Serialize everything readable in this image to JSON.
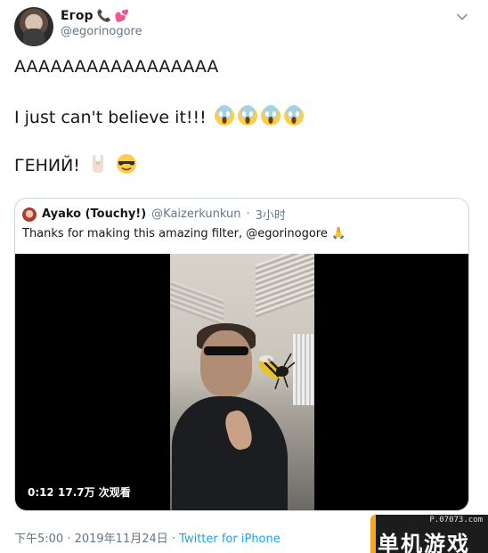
{
  "author": {
    "display_name": "Егор",
    "handle": "@egorinogore"
  },
  "tweet_lines": [
    "AAAAAAAAAAAAAAAAA",
    "I just can't believe it!!!",
    "ГЕНИЙ!"
  ],
  "quoted": {
    "name": "Ayako (Touchy!)",
    "handle": "@Kaizerkunkun",
    "separator": "·",
    "time": "3小时",
    "text": "Thanks for making this amazing filter, @egorinogore 🙏"
  },
  "video": {
    "duration": "0:12",
    "views": "17.7万 次观看"
  },
  "meta": {
    "timestamp": "下午5:00 · 2019年11月24日 · ",
    "source": "Twitter for iPhone"
  },
  "watermark": {
    "site": "P.07073.com",
    "title": "单机游戏"
  },
  "colors": {
    "link": "#1da1f2",
    "secondary_text": "#657786",
    "border": "#ccd6dd"
  }
}
